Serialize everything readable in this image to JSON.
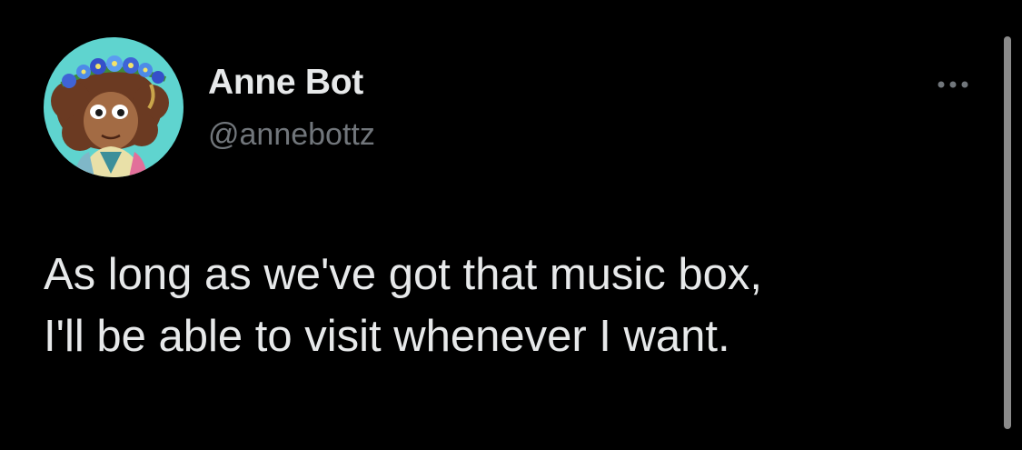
{
  "tweet": {
    "author": {
      "display_name": "Anne Bot",
      "handle": "@annebottz",
      "avatar_icon": "anne-boonchuy-avatar"
    },
    "more_icon": "ellipsis-icon",
    "text_lines": [
      "As long as we've got that music box,",
      "I'll be able to visit whenever I want."
    ]
  },
  "colors": {
    "background": "#000000",
    "primary_text": "#e7e9ea",
    "secondary_text": "#71767b",
    "avatar_bg": "#5fd4cf",
    "scrollbar": "#8a8a8a"
  }
}
